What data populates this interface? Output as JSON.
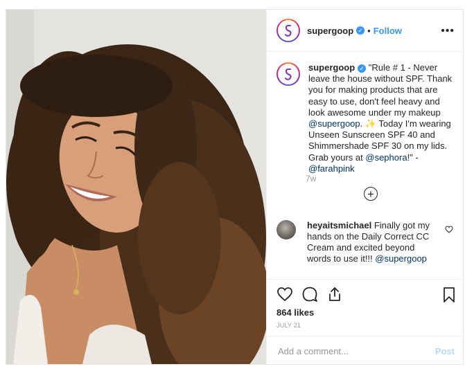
{
  "header": {
    "username": "supergoop",
    "separator": "•",
    "follow_label": "Follow",
    "more_label": "•••"
  },
  "caption": {
    "username": "supergoop",
    "text_part1": " \"Rule # 1 - Never leave the house without SPF. Thank you for making products that are easy to use, don't feel heavy and look awesome under my makeup ",
    "mention1": "@supergoop",
    "text_part2": ". ✨ Today I'm wearing Unseen Sunscreen SPF 40 and Shimmershade SPF 30 on my lids. Grab yours at ",
    "mention2": "@sephora",
    "text_part3": "!\" - ",
    "mention3": "@farahpink",
    "time": "7w"
  },
  "load_more_label": "+",
  "comment": {
    "username": "heyaitsmichael",
    "text": " Finally got my hands on the Daily Correct CC Cream and excited beyond words to use it!!! ",
    "mention": "@supergoop"
  },
  "actions": {
    "likes": "864 likes",
    "date": "JULY 21"
  },
  "add_comment": {
    "placeholder": "Add a comment...",
    "post_label": "Post"
  },
  "colors": {
    "link": "#3897f0",
    "mention": "#003569",
    "post_disabled": "#b3dbff"
  },
  "icons": [
    "supergoop-logo-icon",
    "verified-badge-icon",
    "more-options-icon",
    "plus-circle-icon",
    "heart-outline-icon",
    "comment-icon",
    "share-icon",
    "bookmark-icon"
  ]
}
